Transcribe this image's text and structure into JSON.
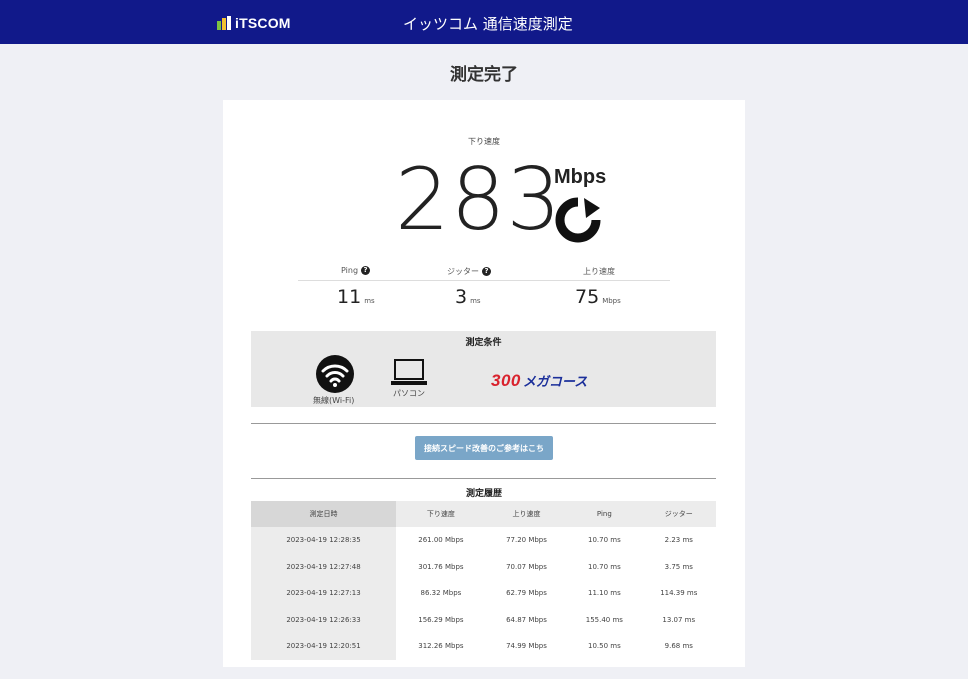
{
  "header": {
    "logo_text": "iTSCOM",
    "title": "イッツコム 通信速度測定"
  },
  "page": {
    "title": "測定完了"
  },
  "result": {
    "download_label": "下り速度",
    "download_value": "283",
    "download_unit": "Mbps",
    "metrics": [
      {
        "label": "Ping",
        "value": "11",
        "unit": "ms",
        "help": true
      },
      {
        "label": "ジッター",
        "value": "3",
        "unit": "ms",
        "help": true
      },
      {
        "label": "上り速度",
        "value": "75",
        "unit": "Mbps",
        "help": false
      }
    ]
  },
  "conditions": {
    "title": "測定条件",
    "connection_label": "無線(Wi-Fi)",
    "device_label": "パソコン",
    "course_number": "300",
    "course_text": "メガコース"
  },
  "cta": {
    "label": "接続スピード改善のご参考はこちら"
  },
  "history": {
    "title": "測定履歴",
    "columns": [
      "測定日時",
      "下り速度",
      "上り速度",
      "Ping",
      "ジッター"
    ],
    "rows": [
      [
        "2023-04-19 12:28:35",
        "261.00 Mbps",
        "77.20 Mbps",
        "10.70 ms",
        "2.23 ms"
      ],
      [
        "2023-04-19 12:27:48",
        "301.76 Mbps",
        "70.07 Mbps",
        "10.70 ms",
        "3.75 ms"
      ],
      [
        "2023-04-19 12:27:13",
        "86.32 Mbps",
        "62.79 Mbps",
        "11.10 ms",
        "114.39 ms"
      ],
      [
        "2023-04-19 12:26:33",
        "156.29 Mbps",
        "64.87 Mbps",
        "155.40 ms",
        "13.07 ms"
      ],
      [
        "2023-04-19 12:20:51",
        "312.26 Mbps",
        "74.99 Mbps",
        "10.50 ms",
        "9.68 ms"
      ]
    ]
  },
  "colors": {
    "header_bg": "#11198a",
    "cta_bg": "#7aa6c8",
    "course_number": "#d9232e",
    "course_text": "#1b2f9a"
  },
  "icons": [
    "logo-icon",
    "reload-icon",
    "help-icon",
    "wifi-icon",
    "laptop-icon"
  ]
}
